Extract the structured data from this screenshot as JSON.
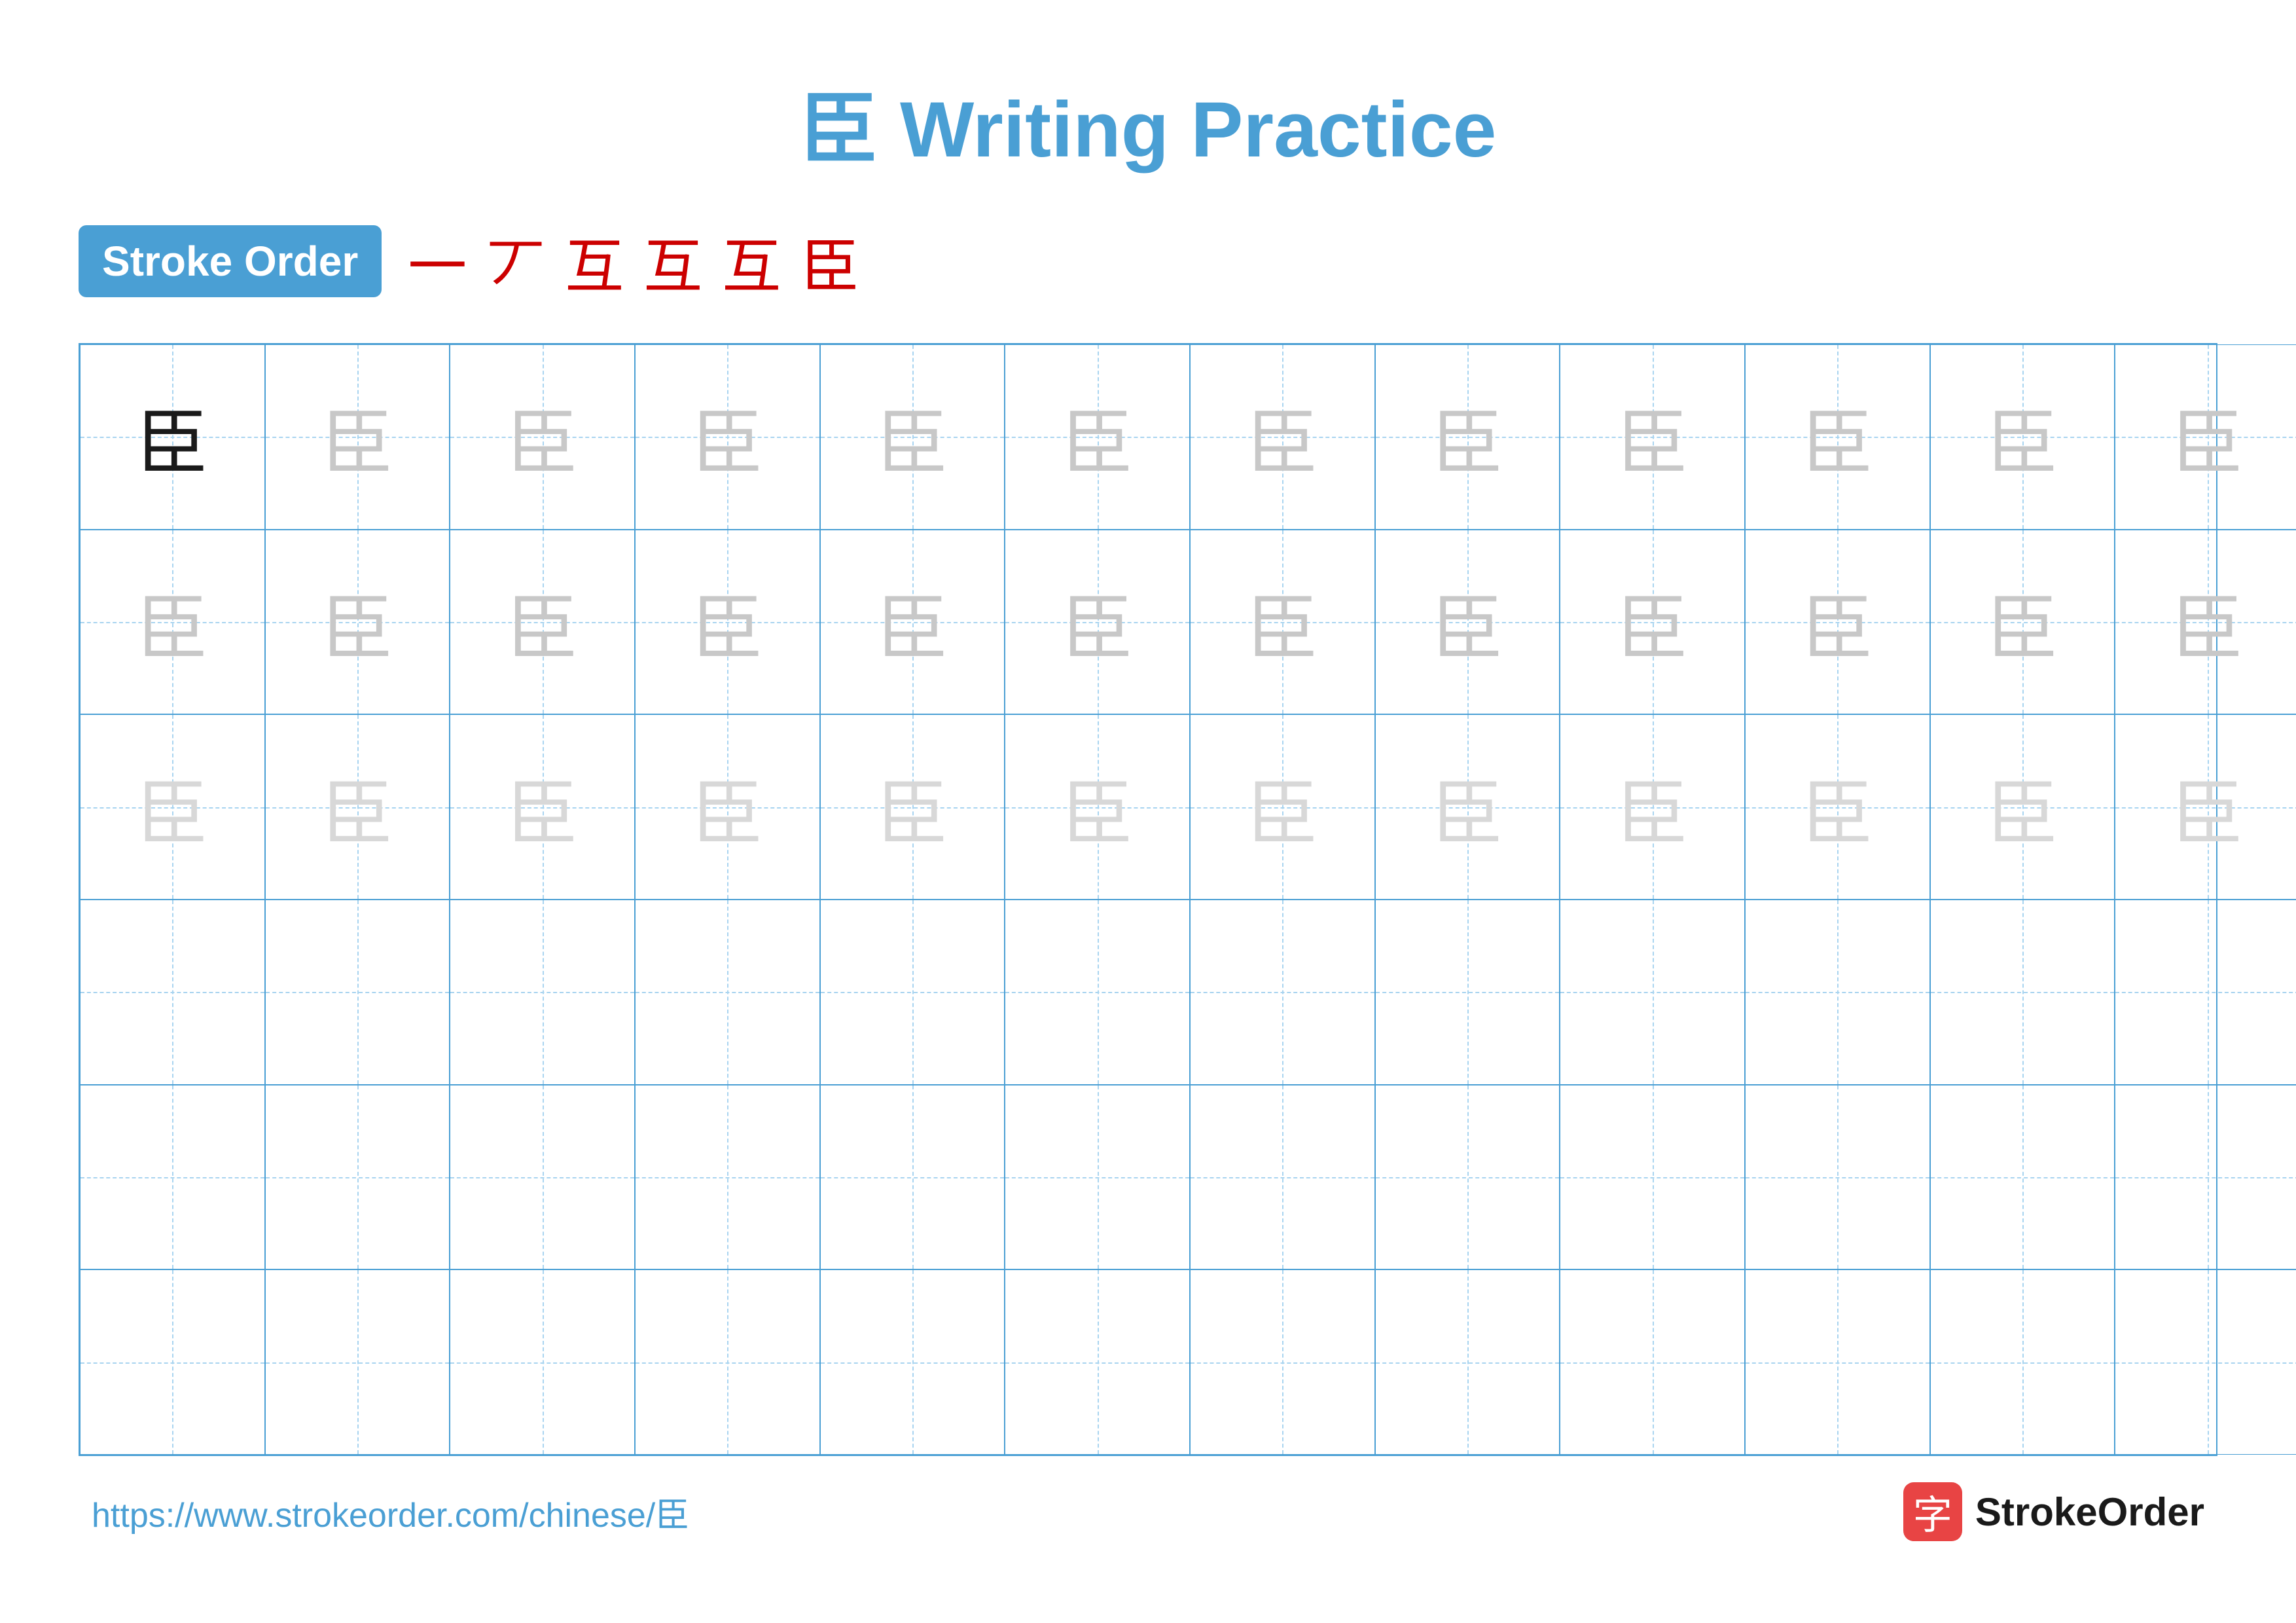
{
  "title": "臣 Writing Practice",
  "stroke_order_label": "Stroke Order",
  "stroke_sequence": [
    "一",
    "丆",
    "互",
    "互",
    "互",
    "臣"
  ],
  "character": "臣",
  "grid": {
    "cols": 13,
    "rows": 6,
    "cells": [
      {
        "row": 0,
        "col": 0,
        "style": "dark"
      },
      {
        "row": 0,
        "col": 1,
        "style": "medium"
      },
      {
        "row": 0,
        "col": 2,
        "style": "medium"
      },
      {
        "row": 0,
        "col": 3,
        "style": "medium"
      },
      {
        "row": 0,
        "col": 4,
        "style": "medium"
      },
      {
        "row": 0,
        "col": 5,
        "style": "medium"
      },
      {
        "row": 0,
        "col": 6,
        "style": "medium"
      },
      {
        "row": 0,
        "col": 7,
        "style": "medium"
      },
      {
        "row": 0,
        "col": 8,
        "style": "medium"
      },
      {
        "row": 0,
        "col": 9,
        "style": "medium"
      },
      {
        "row": 0,
        "col": 10,
        "style": "medium"
      },
      {
        "row": 0,
        "col": 11,
        "style": "medium"
      },
      {
        "row": 0,
        "col": 12,
        "style": "medium"
      },
      {
        "row": 1,
        "col": 0,
        "style": "medium"
      },
      {
        "row": 1,
        "col": 1,
        "style": "medium"
      },
      {
        "row": 1,
        "col": 2,
        "style": "medium"
      },
      {
        "row": 1,
        "col": 3,
        "style": "medium"
      },
      {
        "row": 1,
        "col": 4,
        "style": "medium"
      },
      {
        "row": 1,
        "col": 5,
        "style": "medium"
      },
      {
        "row": 1,
        "col": 6,
        "style": "medium"
      },
      {
        "row": 1,
        "col": 7,
        "style": "medium"
      },
      {
        "row": 1,
        "col": 8,
        "style": "medium"
      },
      {
        "row": 1,
        "col": 9,
        "style": "medium"
      },
      {
        "row": 1,
        "col": 10,
        "style": "medium"
      },
      {
        "row": 1,
        "col": 11,
        "style": "medium"
      },
      {
        "row": 1,
        "col": 12,
        "style": "medium"
      },
      {
        "row": 2,
        "col": 0,
        "style": "light"
      },
      {
        "row": 2,
        "col": 1,
        "style": "light"
      },
      {
        "row": 2,
        "col": 2,
        "style": "light"
      },
      {
        "row": 2,
        "col": 3,
        "style": "light"
      },
      {
        "row": 2,
        "col": 4,
        "style": "light"
      },
      {
        "row": 2,
        "col": 5,
        "style": "light"
      },
      {
        "row": 2,
        "col": 6,
        "style": "light"
      },
      {
        "row": 2,
        "col": 7,
        "style": "light"
      },
      {
        "row": 2,
        "col": 8,
        "style": "light"
      },
      {
        "row": 2,
        "col": 9,
        "style": "light"
      },
      {
        "row": 2,
        "col": 10,
        "style": "light"
      },
      {
        "row": 2,
        "col": 11,
        "style": "light"
      },
      {
        "row": 2,
        "col": 12,
        "style": "light"
      }
    ]
  },
  "footer": {
    "url": "https://www.strokeorder.com/chinese/臣",
    "logo_text": "StrokeOrder",
    "logo_char": "字"
  }
}
